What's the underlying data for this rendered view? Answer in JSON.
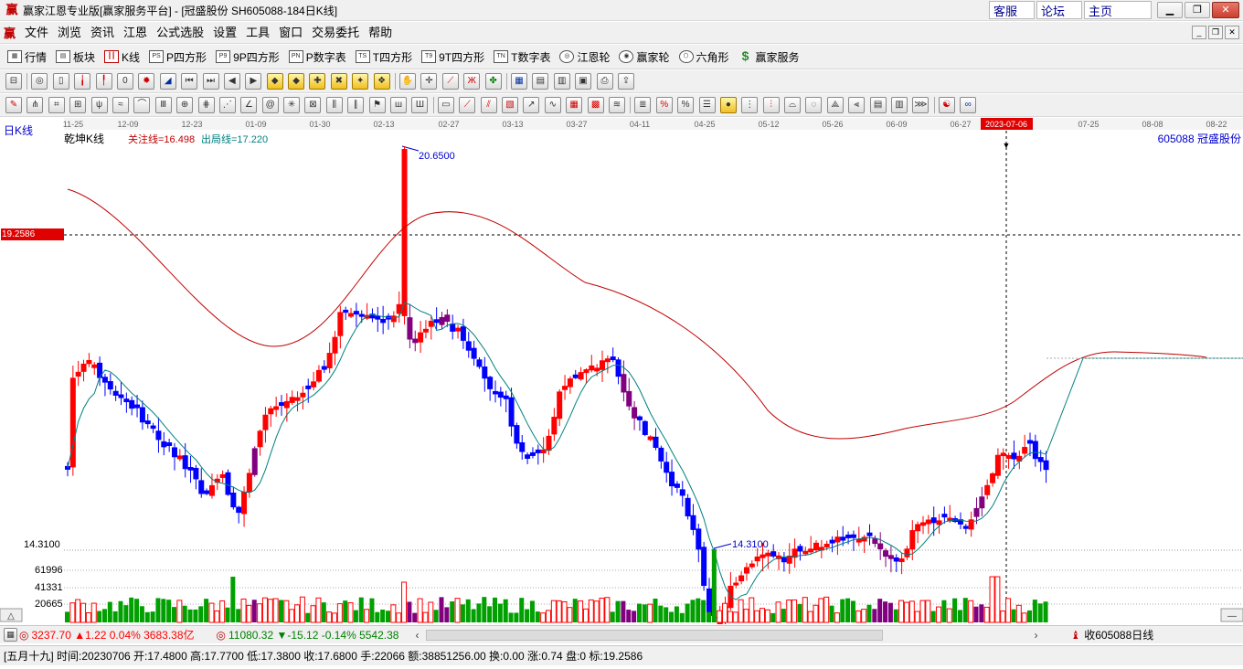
{
  "app": {
    "title": "赢家江恩专业版[赢家服务平台] - [冠盛股份   SH605088-184日K线]",
    "links": [
      "客服",
      "论坛",
      "主页"
    ]
  },
  "menu": [
    "文件",
    "浏览",
    "资讯",
    "江恩",
    "公式选股",
    "设置",
    "工具",
    "窗口",
    "交易委托",
    "帮助"
  ],
  "toolbar": [
    {
      "label": "行情",
      "icon": "grid-icon"
    },
    {
      "label": "板块",
      "icon": "board-icon"
    },
    {
      "label": "K线",
      "icon": "candles-icon"
    },
    {
      "label": "P四方形",
      "icon": "square-p-icon"
    },
    {
      "label": "9P四方形",
      "icon": "square-9p-icon"
    },
    {
      "label": "P数字表",
      "icon": "table-pn-icon"
    },
    {
      "label": "T四方形",
      "icon": "square-t-icon"
    },
    {
      "label": "9T四方形",
      "icon": "square-9t-icon"
    },
    {
      "label": "T数字表",
      "icon": "table-tn-icon"
    },
    {
      "label": "江恩轮",
      "icon": "gann-wheel-icon"
    },
    {
      "label": "赢家轮",
      "icon": "winner-wheel-icon"
    },
    {
      "label": "六角形",
      "icon": "hexagon-icon"
    },
    {
      "label": "赢家服务",
      "icon": "dollar-icon"
    }
  ],
  "chart": {
    "period_label": "日K线",
    "indicator_name": "乾坤K线",
    "focus_line": "关注线=16.498",
    "exit_line": "出局线=17.220",
    "stock": "605088  冠盛股份",
    "price_marker": "19.2586",
    "high_label": "20.6500",
    "low_label": "14.3100",
    "axis_low": "14.3100",
    "vol_labels": [
      "61996",
      "41331",
      "20665"
    ],
    "highlight_date": "2023-07-06",
    "date_ticks": [
      "11-25",
      "12-09",
      "12-23",
      "01-09",
      "01-30",
      "02-13",
      "02-27",
      "03-13",
      "03-27",
      "04-11",
      "04-25",
      "05-12",
      "05-26",
      "06-09",
      "06-27",
      "2023-07-06",
      "07-25",
      "08-08",
      "08-22"
    ]
  },
  "colors": {
    "up": "#ff0000",
    "down": "#0000ff",
    "special": "#800080",
    "mid_line": "#008080",
    "long_line": "#c00000"
  },
  "tickers": [
    {
      "text": "3237.70 ▲1.22 0.04% 3683.38亿",
      "color": "#ff0000"
    },
    {
      "text": "11080.32 ▼-15.12 -0.14% 5542.38",
      "color": "#008000"
    }
  ],
  "ticker_right": "收605088日线",
  "status": "[五月十九] 时间:20230706 开:17.4800 高:17.7700 低:17.3800 收:17.6800 手:22066 额:38851256.00 换:0.00 涨:0.74 盘:0 标:19.2586"
}
